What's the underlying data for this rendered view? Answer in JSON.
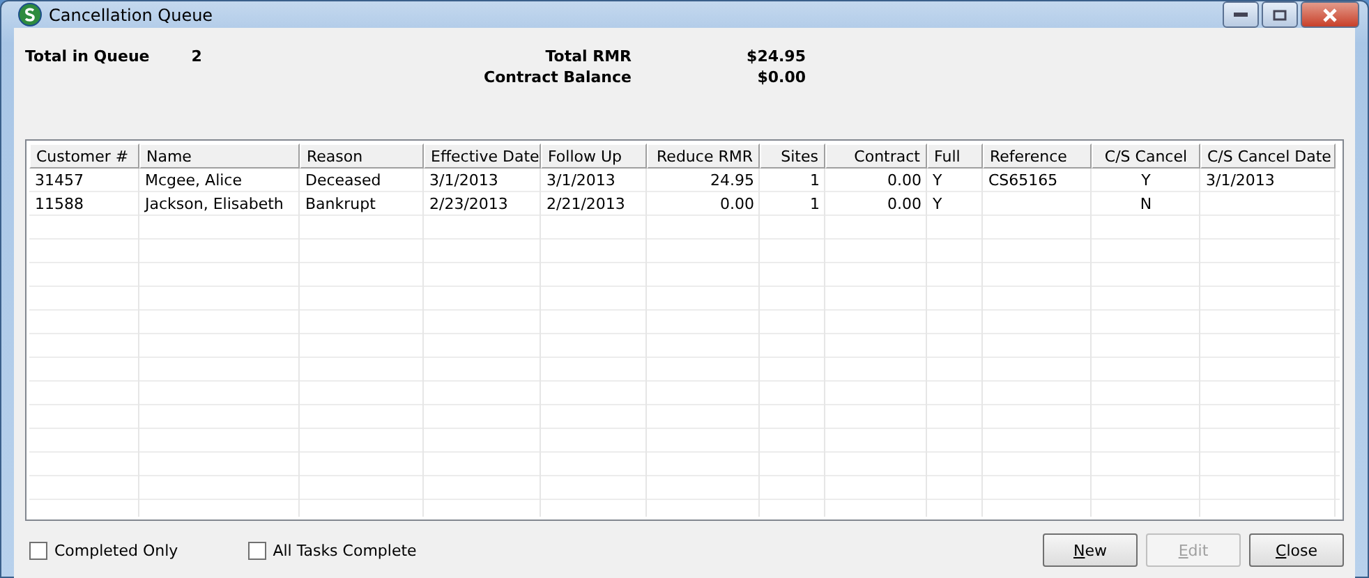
{
  "window": {
    "title": "Cancellation Queue"
  },
  "summary": {
    "total_in_queue": {
      "label": "Total in Queue",
      "value": "2"
    },
    "totals": [
      {
        "label": "Total RMR",
        "value": "$24.95"
      },
      {
        "label": "Contract Balance",
        "value": "$0.00"
      }
    ]
  },
  "table": {
    "columns": [
      "Customer #",
      "Name",
      "Reason",
      "Effective Date",
      "Follow Up",
      "Reduce RMR",
      "Sites",
      "Contract",
      "Full",
      "Reference",
      "C/S Cancel",
      "C/S Cancel Date"
    ],
    "rows": [
      [
        "31457",
        "Mcgee, Alice",
        "Deceased",
        "3/1/2013",
        "3/1/2013",
        "24.95",
        "1",
        "0.00",
        "Y",
        "CS65165",
        "Y",
        "3/1/2013"
      ],
      [
        "11588",
        "Jackson, Elisabeth",
        "Bankrupt",
        "2/23/2013",
        "2/21/2013",
        "0.00",
        "1",
        "0.00",
        "Y",
        "",
        "N",
        ""
      ]
    ]
  },
  "filters": [
    {
      "label": "Completed Only",
      "checked": false
    },
    {
      "label": "All Tasks Complete",
      "checked": false
    }
  ],
  "buttons": [
    {
      "label": "New",
      "disabled": false
    },
    {
      "label": "Edit",
      "disabled": true
    },
    {
      "label": "Close",
      "disabled": false
    }
  ]
}
